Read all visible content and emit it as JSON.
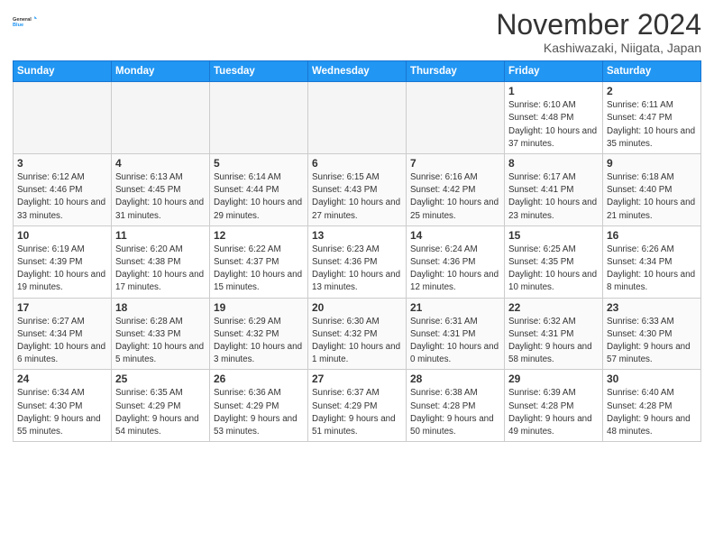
{
  "logo": {
    "line1": "General",
    "line2": "Blue"
  },
  "title": "November 2024",
  "location": "Kashiwazaki, Niigata, Japan",
  "weekdays": [
    "Sunday",
    "Monday",
    "Tuesday",
    "Wednesday",
    "Thursday",
    "Friday",
    "Saturday"
  ],
  "weeks": [
    [
      {
        "day": "",
        "info": ""
      },
      {
        "day": "",
        "info": ""
      },
      {
        "day": "",
        "info": ""
      },
      {
        "day": "",
        "info": ""
      },
      {
        "day": "",
        "info": ""
      },
      {
        "day": "1",
        "info": "Sunrise: 6:10 AM\nSunset: 4:48 PM\nDaylight: 10 hours\nand 37 minutes."
      },
      {
        "day": "2",
        "info": "Sunrise: 6:11 AM\nSunset: 4:47 PM\nDaylight: 10 hours\nand 35 minutes."
      }
    ],
    [
      {
        "day": "3",
        "info": "Sunrise: 6:12 AM\nSunset: 4:46 PM\nDaylight: 10 hours\nand 33 minutes."
      },
      {
        "day": "4",
        "info": "Sunrise: 6:13 AM\nSunset: 4:45 PM\nDaylight: 10 hours\nand 31 minutes."
      },
      {
        "day": "5",
        "info": "Sunrise: 6:14 AM\nSunset: 4:44 PM\nDaylight: 10 hours\nand 29 minutes."
      },
      {
        "day": "6",
        "info": "Sunrise: 6:15 AM\nSunset: 4:43 PM\nDaylight: 10 hours\nand 27 minutes."
      },
      {
        "day": "7",
        "info": "Sunrise: 6:16 AM\nSunset: 4:42 PM\nDaylight: 10 hours\nand 25 minutes."
      },
      {
        "day": "8",
        "info": "Sunrise: 6:17 AM\nSunset: 4:41 PM\nDaylight: 10 hours\nand 23 minutes."
      },
      {
        "day": "9",
        "info": "Sunrise: 6:18 AM\nSunset: 4:40 PM\nDaylight: 10 hours\nand 21 minutes."
      }
    ],
    [
      {
        "day": "10",
        "info": "Sunrise: 6:19 AM\nSunset: 4:39 PM\nDaylight: 10 hours\nand 19 minutes."
      },
      {
        "day": "11",
        "info": "Sunrise: 6:20 AM\nSunset: 4:38 PM\nDaylight: 10 hours\nand 17 minutes."
      },
      {
        "day": "12",
        "info": "Sunrise: 6:22 AM\nSunset: 4:37 PM\nDaylight: 10 hours\nand 15 minutes."
      },
      {
        "day": "13",
        "info": "Sunrise: 6:23 AM\nSunset: 4:36 PM\nDaylight: 10 hours\nand 13 minutes."
      },
      {
        "day": "14",
        "info": "Sunrise: 6:24 AM\nSunset: 4:36 PM\nDaylight: 10 hours\nand 12 minutes."
      },
      {
        "day": "15",
        "info": "Sunrise: 6:25 AM\nSunset: 4:35 PM\nDaylight: 10 hours\nand 10 minutes."
      },
      {
        "day": "16",
        "info": "Sunrise: 6:26 AM\nSunset: 4:34 PM\nDaylight: 10 hours\nand 8 minutes."
      }
    ],
    [
      {
        "day": "17",
        "info": "Sunrise: 6:27 AM\nSunset: 4:34 PM\nDaylight: 10 hours\nand 6 minutes."
      },
      {
        "day": "18",
        "info": "Sunrise: 6:28 AM\nSunset: 4:33 PM\nDaylight: 10 hours\nand 5 minutes."
      },
      {
        "day": "19",
        "info": "Sunrise: 6:29 AM\nSunset: 4:32 PM\nDaylight: 10 hours\nand 3 minutes."
      },
      {
        "day": "20",
        "info": "Sunrise: 6:30 AM\nSunset: 4:32 PM\nDaylight: 10 hours\nand 1 minute."
      },
      {
        "day": "21",
        "info": "Sunrise: 6:31 AM\nSunset: 4:31 PM\nDaylight: 10 hours\nand 0 minutes."
      },
      {
        "day": "22",
        "info": "Sunrise: 6:32 AM\nSunset: 4:31 PM\nDaylight: 9 hours\nand 58 minutes."
      },
      {
        "day": "23",
        "info": "Sunrise: 6:33 AM\nSunset: 4:30 PM\nDaylight: 9 hours\nand 57 minutes."
      }
    ],
    [
      {
        "day": "24",
        "info": "Sunrise: 6:34 AM\nSunset: 4:30 PM\nDaylight: 9 hours\nand 55 minutes."
      },
      {
        "day": "25",
        "info": "Sunrise: 6:35 AM\nSunset: 4:29 PM\nDaylight: 9 hours\nand 54 minutes."
      },
      {
        "day": "26",
        "info": "Sunrise: 6:36 AM\nSunset: 4:29 PM\nDaylight: 9 hours\nand 53 minutes."
      },
      {
        "day": "27",
        "info": "Sunrise: 6:37 AM\nSunset: 4:29 PM\nDaylight: 9 hours\nand 51 minutes."
      },
      {
        "day": "28",
        "info": "Sunrise: 6:38 AM\nSunset: 4:28 PM\nDaylight: 9 hours\nand 50 minutes."
      },
      {
        "day": "29",
        "info": "Sunrise: 6:39 AM\nSunset: 4:28 PM\nDaylight: 9 hours\nand 49 minutes."
      },
      {
        "day": "30",
        "info": "Sunrise: 6:40 AM\nSunset: 4:28 PM\nDaylight: 9 hours\nand 48 minutes."
      }
    ]
  ]
}
